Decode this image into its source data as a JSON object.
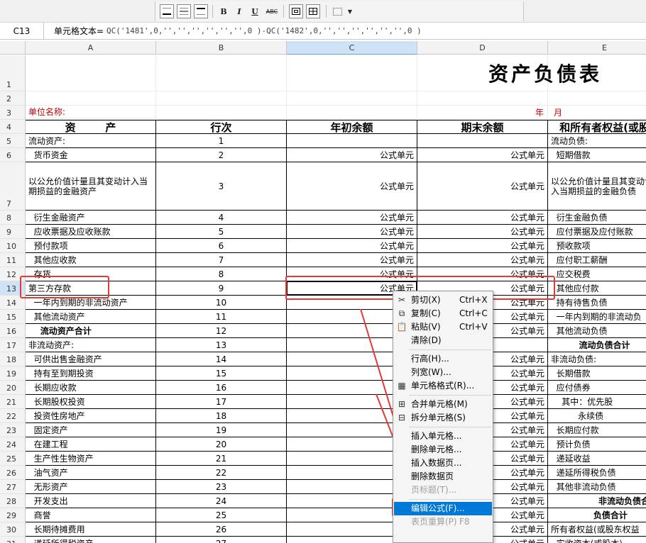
{
  "toolbar": {
    "bold": "B",
    "italic": "I",
    "underline": "U",
    "strike": "ABC"
  },
  "formula_bar": {
    "cell_ref": "C13",
    "label": "单元格文本=",
    "text": "QC('1481',0,'','','','','','',0 )-QC('1482',0,'','','','','','',0 )"
  },
  "columns": [
    "A",
    "B",
    "C",
    "D",
    "E"
  ],
  "sheet": {
    "title": "资产负债表",
    "unit_label": "单位名称:",
    "year_label": "年",
    "month_label": "月",
    "headers": [
      "资        产",
      "行次",
      "年初余额",
      "期末余额",
      "和所有者权益(或股"
    ],
    "formula_cell": "公式单元",
    "rows": [
      {
        "n": "1",
        "a": "",
        "b": "",
        "c": "",
        "d": "",
        "e": ""
      },
      {
        "n": "2",
        "a": "",
        "b": "",
        "c": "",
        "d": "",
        "e": ""
      },
      {
        "n": "3",
        "a": "",
        "b": "",
        "c": "",
        "d": "",
        "e": ""
      },
      {
        "n": "4",
        "a": "",
        "b": "",
        "c": "",
        "d": "",
        "e": ""
      },
      {
        "n": "5",
        "a": "流动资产:",
        "b": "1",
        "c": "",
        "d": "",
        "e": "流动负债:"
      },
      {
        "n": "6",
        "a": "  货币资金",
        "b": "2",
        "c": "公式单元",
        "d": "公式单元",
        "e": "  短期借款"
      },
      {
        "n": "7",
        "a": "  以公允价值计量且其变动计入当期损益的金融资产",
        "b": "3",
        "c": "公式单元",
        "d": "公式单元",
        "e": "  以公允价值计量且其变动计入当期损益的金融负债"
      },
      {
        "n": "8",
        "a": "  衍生金融资产",
        "b": "4",
        "c": "公式单元",
        "d": "公式单元",
        "e": "  衍生金融负债"
      },
      {
        "n": "9",
        "a": "  应收票据及应收账款",
        "b": "5",
        "c": "公式单元",
        "d": "公式单元",
        "e": "  应付票据及应付账款"
      },
      {
        "n": "10",
        "a": "  预付款项",
        "b": "6",
        "c": "公式单元",
        "d": "公式单元",
        "e": "  预收款项"
      },
      {
        "n": "11",
        "a": "  其他应收款",
        "b": "7",
        "c": "公式单元",
        "d": "公式单元",
        "e": "  应付职工薪酬"
      },
      {
        "n": "12",
        "a": "  存货",
        "b": "8",
        "c": "公式单元",
        "d": "公式单元",
        "e": "  应交税费"
      },
      {
        "n": "13",
        "a": "第三方存款",
        "b": "9",
        "c": "公式单元",
        "d": "公式单元",
        "e": "  其他应付款"
      },
      {
        "n": "14",
        "a": "  一年内到期的非流动资产",
        "b": "10",
        "c": "",
        "d": "公式单元",
        "e": "  持有待售负债"
      },
      {
        "n": "15",
        "a": "  其他流动资产",
        "b": "11",
        "c": "公式",
        "d": "公式单元",
        "e": "  一年内到期的非流动负"
      },
      {
        "n": "16",
        "a": "    流动资产合计",
        "b": "12",
        "c": "公式",
        "d": "公式单元",
        "e": "  其他流动负债"
      },
      {
        "n": "17",
        "a": "非流动资产:",
        "b": "13",
        "c": "",
        "d": "",
        "e": "流动负债合计"
      },
      {
        "n": "18",
        "a": "  可供出售金融资产",
        "b": "14",
        "c": "公式",
        "d": "公式单元",
        "e": "非流动负债:"
      },
      {
        "n": "19",
        "a": "  持有至到期投资",
        "b": "15",
        "c": "公式",
        "d": "公式单元",
        "e": "  长期借款"
      },
      {
        "n": "20",
        "a": "  长期应收款",
        "b": "16",
        "c": "公式",
        "d": "公式单元",
        "e": "  应付债券"
      },
      {
        "n": "21",
        "a": "  长期股权投资",
        "b": "17",
        "c": "公式",
        "d": "公式单元",
        "e": "    其中：优先股"
      },
      {
        "n": "22",
        "a": "  投资性房地产",
        "b": "18",
        "c": "公式",
        "d": "公式单元",
        "e": "          永续债"
      },
      {
        "n": "23",
        "a": "  固定资产",
        "b": "19",
        "c": "公式",
        "d": "公式单元",
        "e": "  长期应付款"
      },
      {
        "n": "24",
        "a": "  在建工程",
        "b": "20",
        "c": "公式",
        "d": "公式单元",
        "e": "  预计负债"
      },
      {
        "n": "25",
        "a": "  生产性生物资产",
        "b": "21",
        "c": "公式",
        "d": "公式单元",
        "e": "  递延收益"
      },
      {
        "n": "26",
        "a": "  油气资产",
        "b": "22",
        "c": "公式",
        "d": "公式单元",
        "e": "  递延所得税负债"
      },
      {
        "n": "27",
        "a": "  无形资产",
        "b": "23",
        "c": "公式",
        "d": "公式单元",
        "e": "  其他非流动负债"
      },
      {
        "n": "28",
        "a": "  开发支出",
        "b": "24",
        "c": "公式",
        "d": "公式单元",
        "e": "  非流动负债合计"
      },
      {
        "n": "29",
        "a": "  商誉",
        "b": "25",
        "c": "公式",
        "d": "公式单元",
        "e": "    负债合计"
      },
      {
        "n": "30",
        "a": "  长期待摊费用",
        "b": "26",
        "c": "公式",
        "d": "公式单元",
        "e": "所有者权益(或股东权益"
      },
      {
        "n": "31",
        "a": "  递延所得税资产",
        "b": "27",
        "c": "公式",
        "d": "公式单元",
        "e": "  实收资本(或股本)"
      }
    ]
  },
  "context_menu": [
    {
      "label": "剪切(X)",
      "shortcut": "Ctrl+X",
      "icon": "scissors-icon",
      "disabled": false
    },
    {
      "label": "复制(C)",
      "shortcut": "Ctrl+C",
      "icon": "copy-icon",
      "disabled": false
    },
    {
      "label": "粘贴(V)",
      "shortcut": "Ctrl+V",
      "icon": "paste-icon",
      "disabled": false
    },
    {
      "label": "清除(D)",
      "shortcut": "",
      "icon": "",
      "disabled": false
    },
    {
      "label": "行高(H)...",
      "shortcut": "",
      "icon": "",
      "disabled": false
    },
    {
      "label": "列宽(W)...",
      "shortcut": "",
      "icon": "",
      "disabled": false
    },
    {
      "label": "单元格格式(R)...",
      "shortcut": "",
      "icon": "format-cells-icon",
      "disabled": false
    },
    {
      "label": "合并单元格(M)",
      "shortcut": "",
      "icon": "merge-cells-icon",
      "disabled": false
    },
    {
      "label": "拆分单元格(S)",
      "shortcut": "",
      "icon": "split-cells-icon",
      "disabled": false
    },
    {
      "label": "插入单元格...",
      "shortcut": "",
      "icon": "",
      "disabled": false
    },
    {
      "label": "删除单元格...",
      "shortcut": "",
      "icon": "",
      "disabled": false
    },
    {
      "label": "插入数据页...",
      "shortcut": "",
      "icon": "",
      "disabled": false
    },
    {
      "label": "删除数据页",
      "shortcut": "",
      "icon": "",
      "disabled": false
    },
    {
      "label": "页标题(T)...",
      "shortcut": "",
      "icon": "",
      "disabled": true
    },
    {
      "label": "编辑公式(F)...",
      "shortcut": "",
      "icon": "",
      "disabled": false,
      "highlighted": true
    },
    {
      "label": "表页重算(P)",
      "shortcut": "F8",
      "icon": "",
      "disabled": true
    }
  ],
  "colors": {
    "highlight_red": "#e53935",
    "menu_highlight": "#0078d7",
    "red_text": "#cc0000"
  }
}
